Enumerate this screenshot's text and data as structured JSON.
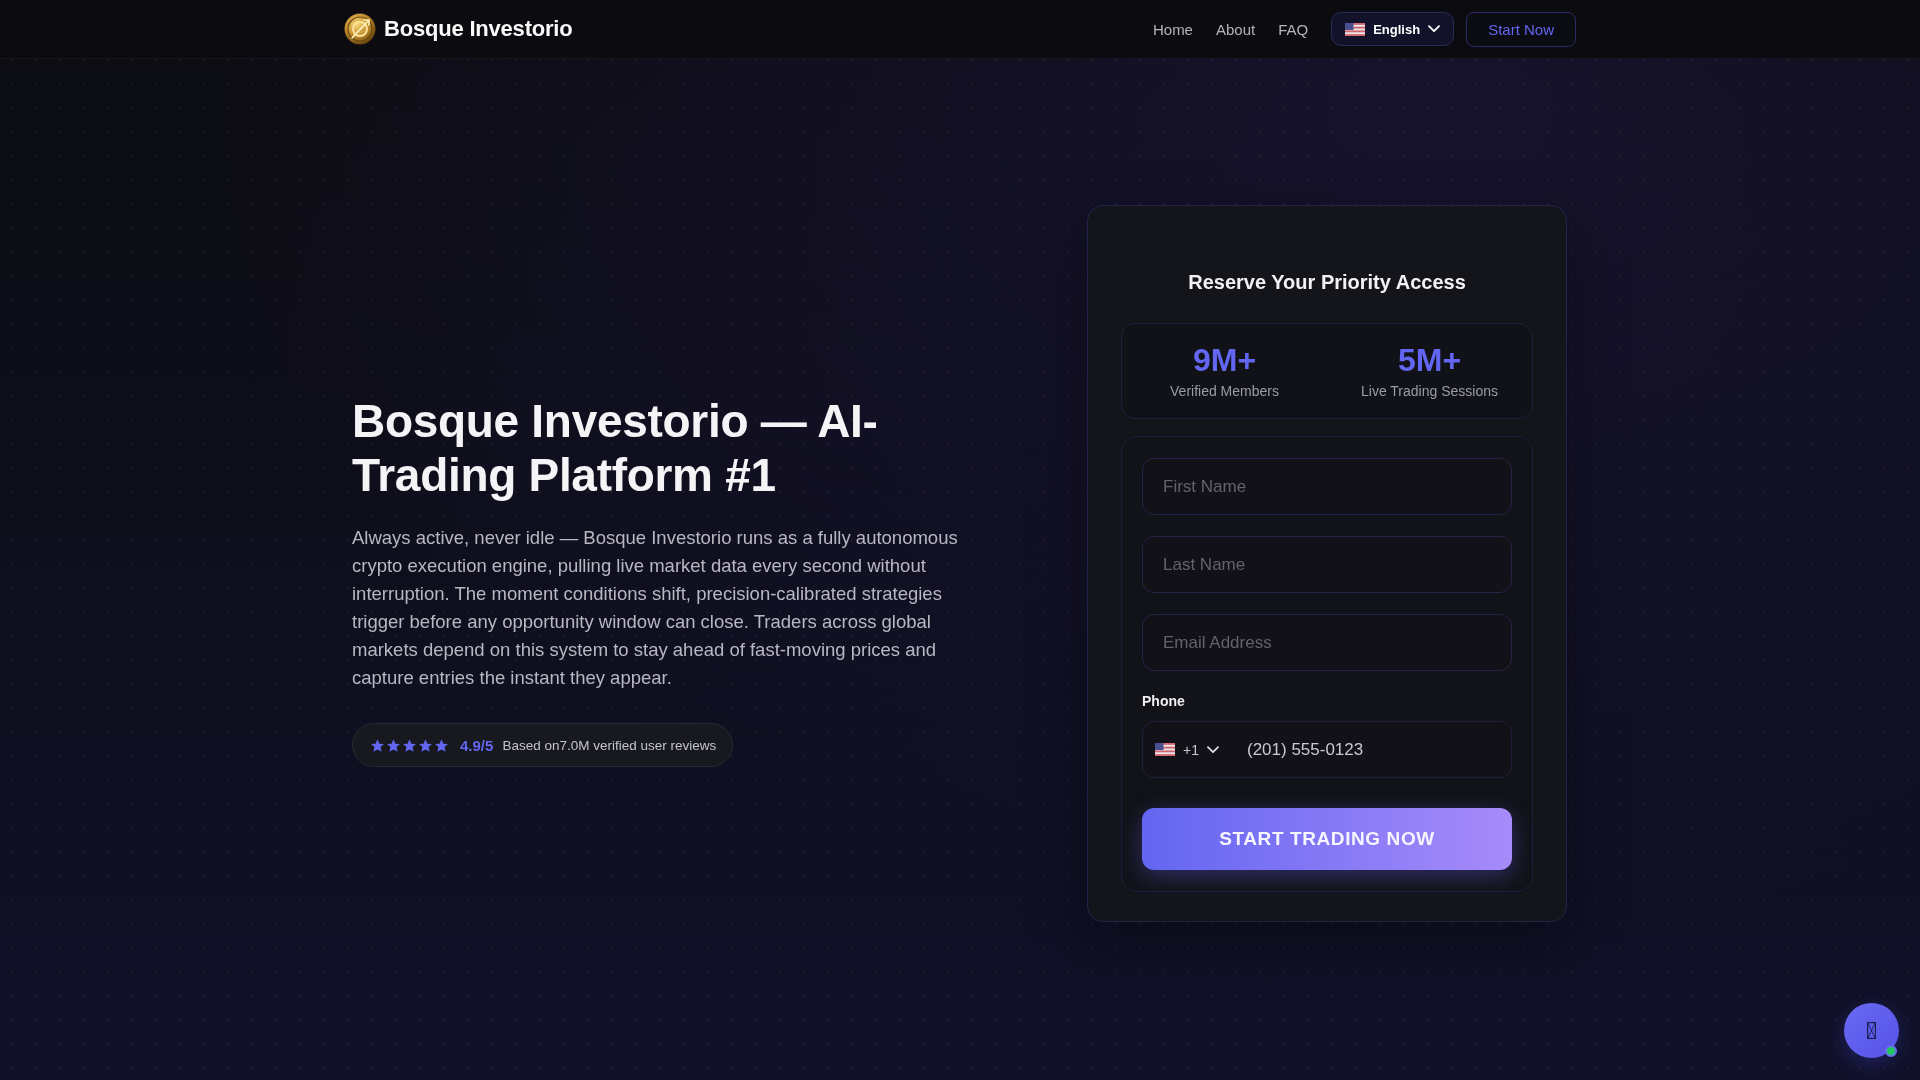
{
  "header": {
    "brand": "Bosque Investorio",
    "nav": [
      "Home",
      "About",
      "FAQ"
    ],
    "language": "English",
    "cta": "Start Now"
  },
  "hero": {
    "title": "Bosque Investorio — AI-Trading Platform #1",
    "description": "Always active, never idle — Bosque Investorio runs as a fully autonomous crypto execution engine, pulling live market data every second without interruption. The moment conditions shift, precision-calibrated strategies trigger before any opportunity window can close. Traders across global markets depend on this system to stay ahead of fast-moving prices and capture entries the instant they appear.",
    "rating": {
      "stars": 5,
      "score": "4.9/5",
      "text": "Based on7.0M verified user reviews"
    }
  },
  "signup_card": {
    "title": "Reserve Your Priority Access",
    "stats": [
      {
        "value": "9M+",
        "label": "Verified Members"
      },
      {
        "value": "5M+",
        "label": "Live Trading Sessions"
      }
    ],
    "fields": [
      {
        "placeholder": "First Name"
      },
      {
        "placeholder": "Last Name"
      },
      {
        "placeholder": "Email Address"
      }
    ],
    "phone": {
      "label": "Phone",
      "country_code": "+1",
      "value": "(201) 555-0123"
    },
    "submit": "START TRADING NOW"
  },
  "chat_button": {
    "online": true
  }
}
